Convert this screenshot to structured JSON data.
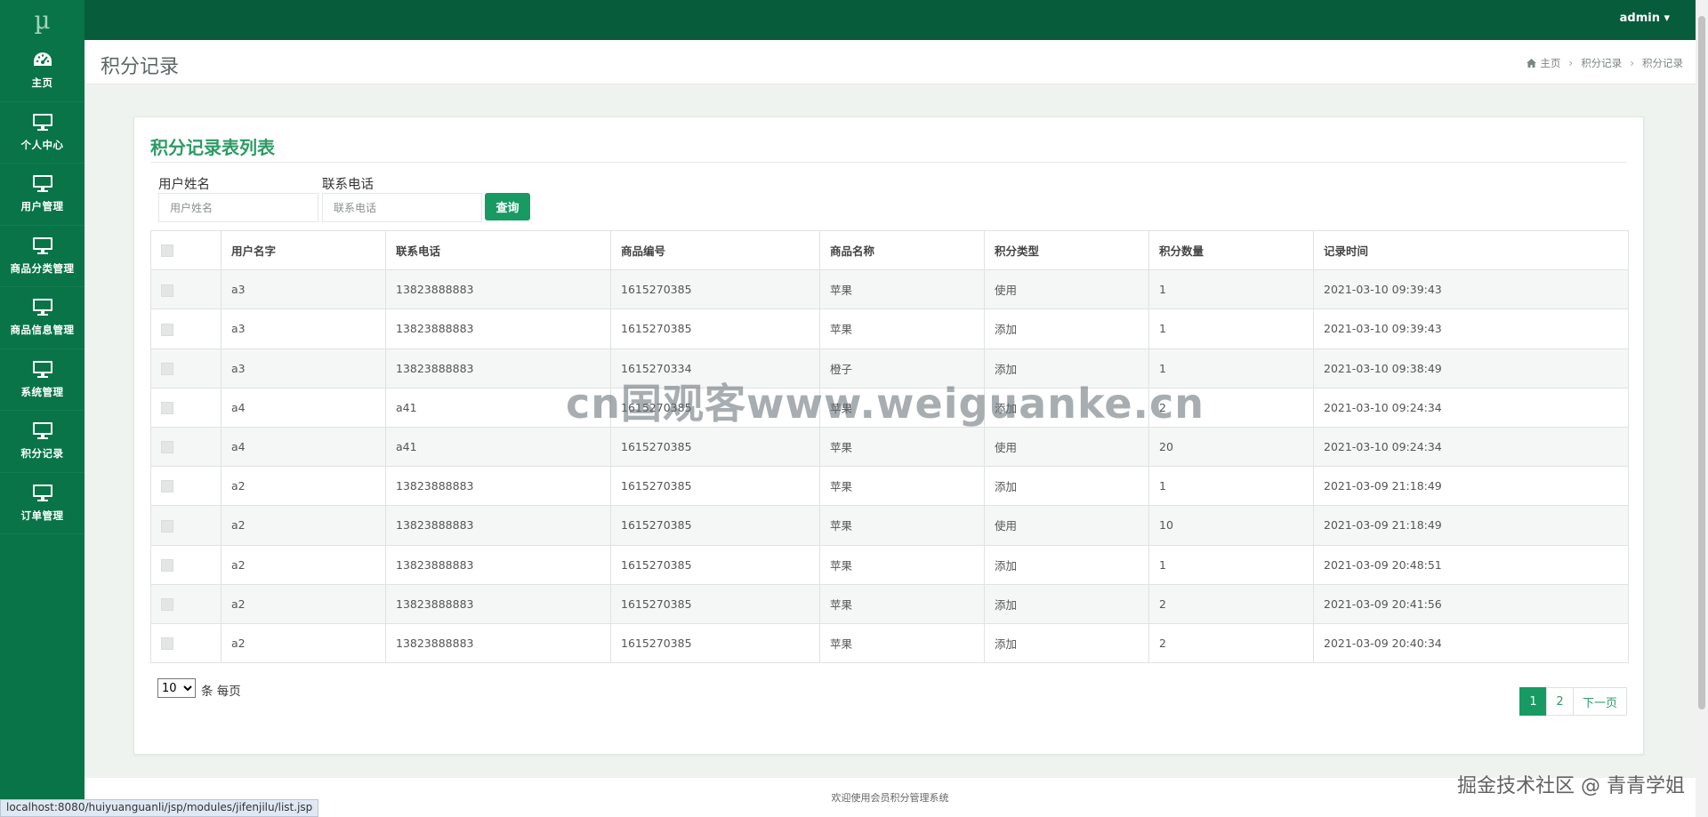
{
  "app": {
    "logo_text": "µ",
    "user_label": "admin ▾"
  },
  "sidebar": {
    "items": [
      {
        "label": "主页",
        "icon": "dashboard-icon"
      },
      {
        "label": "个人中心",
        "icon": "monitor-icon"
      },
      {
        "label": "用户管理",
        "icon": "monitor-icon"
      },
      {
        "label": "商品分类管理",
        "icon": "monitor-icon"
      },
      {
        "label": "商品信息管理",
        "icon": "monitor-icon"
      },
      {
        "label": "系统管理",
        "icon": "monitor-icon"
      },
      {
        "label": "积分记录",
        "icon": "monitor-icon"
      },
      {
        "label": "订单管理",
        "icon": "monitor-icon"
      }
    ]
  },
  "header": {
    "title": "积分记录",
    "breadcrumb": [
      "主页",
      "积分记录",
      "积分记录"
    ],
    "breadcrumb_icon": "home-icon"
  },
  "panel": {
    "title": "积分记录表列表",
    "search": {
      "name_label": "用户姓名",
      "name_placeholder": "用户姓名",
      "phone_label": "联系电话",
      "phone_placeholder": "联系电话",
      "button_label": "查询"
    },
    "table": {
      "columns": [
        "用户名字",
        "联系电话",
        "商品编号",
        "商品名称",
        "积分类型",
        "积分数量",
        "记录时间"
      ],
      "rows": [
        [
          "a3",
          "13823888883",
          "1615270385",
          "苹果",
          "使用",
          "1",
          "2021-03-10 09:39:43"
        ],
        [
          "a3",
          "13823888883",
          "1615270385",
          "苹果",
          "添加",
          "1",
          "2021-03-10 09:39:43"
        ],
        [
          "a3",
          "13823888883",
          "1615270334",
          "橙子",
          "添加",
          "1",
          "2021-03-10 09:38:49"
        ],
        [
          "a4",
          "a41",
          "1615270385",
          "苹果",
          "添加",
          "2",
          "2021-03-10 09:24:34"
        ],
        [
          "a4",
          "a41",
          "1615270385",
          "苹果",
          "使用",
          "20",
          "2021-03-10 09:24:34"
        ],
        [
          "a2",
          "13823888883",
          "1615270385",
          "苹果",
          "添加",
          "1",
          "2021-03-09 21:18:49"
        ],
        [
          "a2",
          "13823888883",
          "1615270385",
          "苹果",
          "使用",
          "10",
          "2021-03-09 21:18:49"
        ],
        [
          "a2",
          "13823888883",
          "1615270385",
          "苹果",
          "添加",
          "1",
          "2021-03-09 20:48:51"
        ],
        [
          "a2",
          "13823888883",
          "1615270385",
          "苹果",
          "添加",
          "2",
          "2021-03-09 20:41:56"
        ],
        [
          "a2",
          "13823888883",
          "1615270385",
          "苹果",
          "添加",
          "2",
          "2021-03-09 20:40:34"
        ]
      ]
    },
    "page_size": {
      "selected": "10",
      "suffix": "条 每页"
    },
    "pagination": {
      "pages": [
        "1",
        "2"
      ],
      "current": "1",
      "next_label": "下一页"
    }
  },
  "footer": {
    "text": "欢迎使用会员积分管理系统"
  },
  "status_url": "localhost:8080/huiyuanguanli/jsp/modules/jifenjilu/list.jsp",
  "watermarks": {
    "center": "cn国观客www.weiguanke.cn",
    "corner": "掘金技术社区 @ 青青学姐"
  },
  "colors": {
    "sidebar": "#087448",
    "topbar": "#075c3c",
    "accent": "#189a63",
    "title_green": "#2c9b66"
  }
}
